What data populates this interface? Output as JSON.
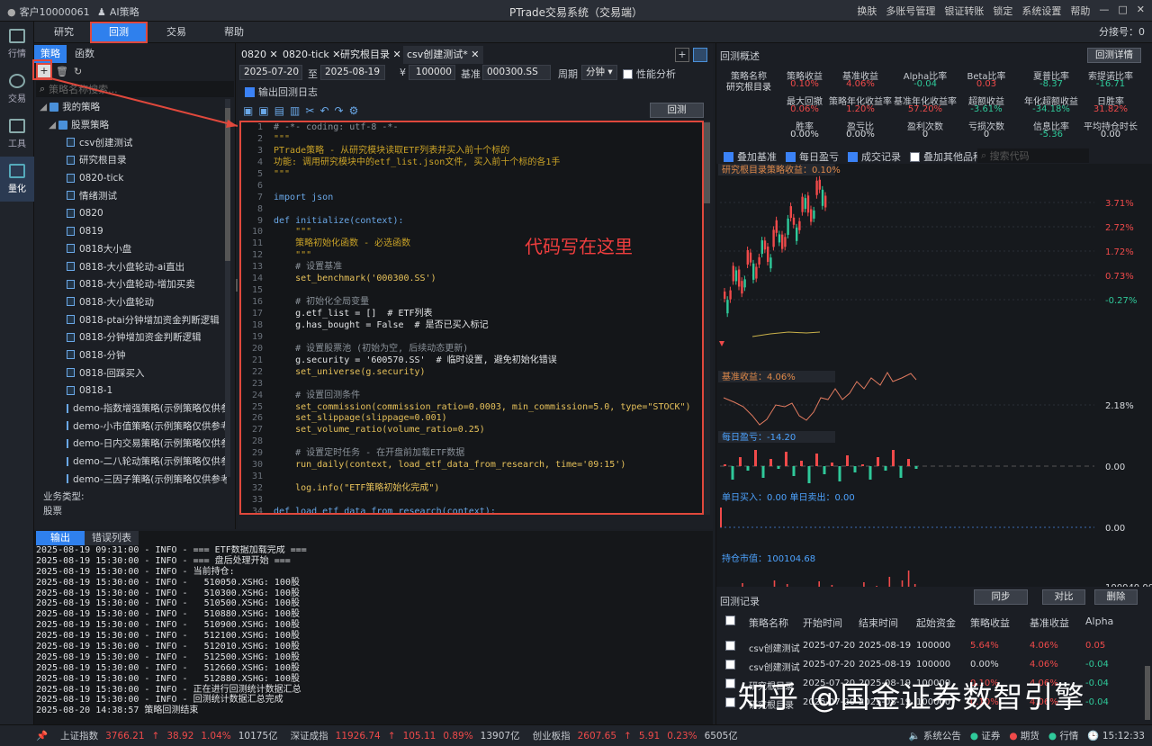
{
  "titlebar": {
    "account": "客户10000061",
    "ai": "AI策略",
    "title": "PTrade交易系统（交易端）",
    "menu": [
      "换肤",
      "多账号管理",
      "银证转账",
      "锁定",
      "系统设置",
      "帮助"
    ]
  },
  "rail": [
    {
      "label": "行情"
    },
    {
      "label": "交易"
    },
    {
      "label": "工具"
    },
    {
      "label": "量化"
    }
  ],
  "toptabs": [
    "研究",
    "回测",
    "交易",
    "帮助"
  ],
  "fenhao": "分接号：0",
  "left": {
    "tabs": [
      "策略",
      "函数"
    ],
    "search_placeholder": "策略名称搜索...",
    "root": "我的策略",
    "group": "股票策略",
    "items": [
      "csv创建测试",
      "研究根目录",
      "0820-tick",
      "情绪测试",
      "0820",
      "0819",
      "0818大小盘",
      "0818-大小盘轮动-ai直出",
      "0818-大小盘轮动-增加买卖",
      "0818-大小盘轮动",
      "0818-ptai分钟增加资金判断逻辑",
      "0818-分钟增加资金判断逻辑",
      "0818-分钟",
      "0818-回踩买入",
      "0818-1",
      "demo-指数增强策略(示例策略仅供参考)",
      "demo-小市值策略(示例策略仅供参考)",
      "demo-日内交易策略(示例策略仅供参考)",
      "demo-二八轮动策略(示例策略仅供参考)",
      "demo-三因子策略(示例策略仅供参考)"
    ],
    "biz_label": "业务类型:",
    "biz_value": "股票"
  },
  "editor": {
    "tabs": [
      "0820",
      "0820-tick",
      "研究根目录",
      "csv创建测试*"
    ],
    "start_date": "2025-07-20",
    "to": "至",
    "end_date": "2025-08-19",
    "yen": "¥",
    "capital": "100000",
    "bench_label": "基准",
    "bench": "000300.SS",
    "period_label": "周期",
    "period": "分钟",
    "perf": "性能分析",
    "log_label": "输出回测日志",
    "run": "回测",
    "annotation": "代码写在这里"
  },
  "code": [
    "# -*- coding: utf-8 -*-",
    "\"\"\"",
    "PTrade策略 - 从研究模块读取ETF列表并买入前十个标的",
    "功能: 调用研究模块中的etf_list.json文件, 买入前十个标的各1手",
    "\"\"\"",
    "",
    "import json",
    "",
    "def initialize(context):",
    "    \"\"\"",
    "    策略初始化函数 - 必选函数",
    "    \"\"\"",
    "    # 设置基准",
    "    set_benchmark('000300.SS')",
    "",
    "    # 初始化全局变量",
    "    g.etf_list = []  # ETF列表",
    "    g.has_bought = False  # 是否已买入标记",
    "",
    "    # 设置股票池 (初始为空, 后续动态更新)",
    "    g.security = '600570.SS'  # 临时设置, 避免初始化错误",
    "    set_universe(g.security)",
    "",
    "    # 设置回测条件",
    "    set_commission(commission_ratio=0.0003, min_commission=5.0, type=\"STOCK\")",
    "    set_slippage(slippage=0.001)",
    "    set_volume_ratio(volume_ratio=0.25)",
    "",
    "    # 设置定时任务 - 在开盘前加载ETF数据",
    "    run_daily(context, load_etf_data_from_research, time='09:15')",
    "",
    "    log.info(\"ETF策略初始化完成\")",
    "",
    "def load_etf_data_from_research(context):"
  ],
  "console": {
    "tabs": [
      "输出",
      "错误列表"
    ],
    "lines": [
      "2025-08-19 09:31:00 - INFO - === ETF数据加载完成 ===",
      "2025-08-19 15:30:00 - INFO - === 盘后处理开始 ===",
      "2025-08-19 15:30:00 - INFO - 当前持仓:",
      "2025-08-19 15:30:00 - INFO -   510050.XSHG: 100股",
      "2025-08-19 15:30:00 - INFO -   510300.XSHG: 100股",
      "2025-08-19 15:30:00 - INFO -   510500.XSHG: 100股",
      "2025-08-19 15:30:00 - INFO -   510880.XSHG: 100股",
      "2025-08-19 15:30:00 - INFO -   510900.XSHG: 100股",
      "2025-08-19 15:30:00 - INFO -   512100.XSHG: 100股",
      "2025-08-19 15:30:00 - INFO -   512010.XSHG: 100股",
      "2025-08-19 15:30:00 - INFO -   512500.XSHG: 100股",
      "2025-08-19 15:30:00 - INFO -   512660.XSHG: 100股",
      "2025-08-19 15:30:00 - INFO -   512880.XSHG: 100股",
      "2025-08-19 15:30:00 - INFO - 正在进行回测统计数据汇总",
      "2025-08-19 15:30:00 - INFO - 回测统计数据汇总完成",
      "2025-08-20 14:38:57 策略回测结束"
    ]
  },
  "right": {
    "title": "回测概述",
    "detail": "回测详情",
    "stats_row1": [
      {
        "l": "策略名称",
        "v": "研究根目录",
        "c": "white"
      },
      {
        "l": "策略收益",
        "v": "0.10%",
        "c": "red"
      },
      {
        "l": "基准收益",
        "v": "4.06%",
        "c": "red"
      },
      {
        "l": "Alpha比率",
        "v": "-0.04",
        "c": "green"
      },
      {
        "l": "Beta比率",
        "v": "0.03",
        "c": "red"
      },
      {
        "l": "夏普比率",
        "v": "-8.37",
        "c": "green"
      },
      {
        "l": "索提诺比率",
        "v": "-16.71",
        "c": "green"
      }
    ],
    "stats_row2": [
      {
        "l": "最大回撤",
        "v": "0.06%",
        "c": "red"
      },
      {
        "l": "策略年化收益率",
        "v": "1.20%",
        "c": "red"
      },
      {
        "l": "基准年化收益率",
        "v": "57.20%",
        "c": "red"
      },
      {
        "l": "超额收益",
        "v": "-3.61%",
        "c": "green"
      },
      {
        "l": "年化超额收益",
        "v": "-34.18%",
        "c": "green"
      },
      {
        "l": "日胜率",
        "v": "31.82%",
        "c": "red"
      }
    ],
    "stats_row3": [
      {
        "l": "胜率",
        "v": "0.00%",
        "c": "white"
      },
      {
        "l": "盈亏比",
        "v": "0.00%",
        "c": "white"
      },
      {
        "l": "盈利次数",
        "v": "0",
        "c": "white"
      },
      {
        "l": "亏损次数",
        "v": "0",
        "c": "white"
      },
      {
        "l": "信息比率",
        "v": "-5.36",
        "c": "green"
      },
      {
        "l": "平均持仓时长",
        "v": "0.00",
        "c": "white"
      }
    ],
    "checks": [
      "叠加基准",
      "每日盈亏",
      "成交记录",
      "叠加其他品种"
    ],
    "search_placeholder": "搜索代码",
    "ret_label": "研究根目录策略收益：0.10%",
    "ret_ticks": [
      "3.71%",
      "2.72%",
      "1.72%",
      "0.73%",
      "-0.27%"
    ],
    "bench_label": "基准收益：4.06%",
    "bench_tick": "2.18%",
    "daily_label": "每日盈亏：-14.20",
    "daily_tick": "0.00",
    "trade_label": "单日买入：0.00  单日卖出：0.00",
    "trade_tick": "0.00",
    "hold_label": "持仓市值：100104.68",
    "hold_tick": "100040.00",
    "dates": [
      "2025/07",
      "2025/08/08"
    ],
    "records_title": "回测记录",
    "rec_btns": [
      "同步",
      "对比",
      "删除"
    ],
    "rec_headers": [
      "策略名称",
      "开始时间",
      "结束时间",
      "起始资金",
      "策略收益",
      "基准收益",
      "Alpha"
    ],
    "rec_rows": [
      {
        "name": "csv创建测试",
        "start": "2025-07-20",
        "end": "2025-08-19",
        "cap": "100000",
        "ret": "5.64%",
        "rc": "red",
        "bench": "4.06%",
        "alpha": "0.05",
        "ac": "red"
      },
      {
        "name": "csv创建测试",
        "start": "2025-07-20",
        "end": "2025-08-19",
        "cap": "100000",
        "ret": "0.00%",
        "rc": "white",
        "bench": "4.06%",
        "alpha": "-0.04",
        "ac": "green"
      },
      {
        "name": "研究根目录",
        "start": "2025-07-20",
        "end": "2025-08-19",
        "cap": "100000",
        "ret": "0.10%",
        "rc": "red",
        "bench": "4.06%",
        "alpha": "-0.04",
        "ac": "green"
      },
      {
        "name": "研究根目录",
        "start": "2025-07-20",
        "end": "2025-08-19",
        "cap": "100000",
        "ret": "0.10%",
        "rc": "red",
        "bench": "4.06%",
        "alpha": "-0.04",
        "ac": "green"
      }
    ]
  },
  "status": {
    "items": [
      {
        "n": "上证指数",
        "v": "3766.21",
        "d": "38.92",
        "p": "1.04%",
        "a": "10175亿"
      },
      {
        "n": "深证成指",
        "v": "11926.74",
        "d": "105.11",
        "p": "0.89%",
        "a": "13907亿"
      },
      {
        "n": "创业板指",
        "v": "2607.65",
        "d": "5.91",
        "p": "0.23%",
        "a": "6505亿"
      }
    ],
    "right": [
      "系统公告",
      "证券",
      "期货",
      "行情"
    ],
    "time": "15:12:33"
  },
  "watermark": "知乎 @国金证券数智引擎"
}
